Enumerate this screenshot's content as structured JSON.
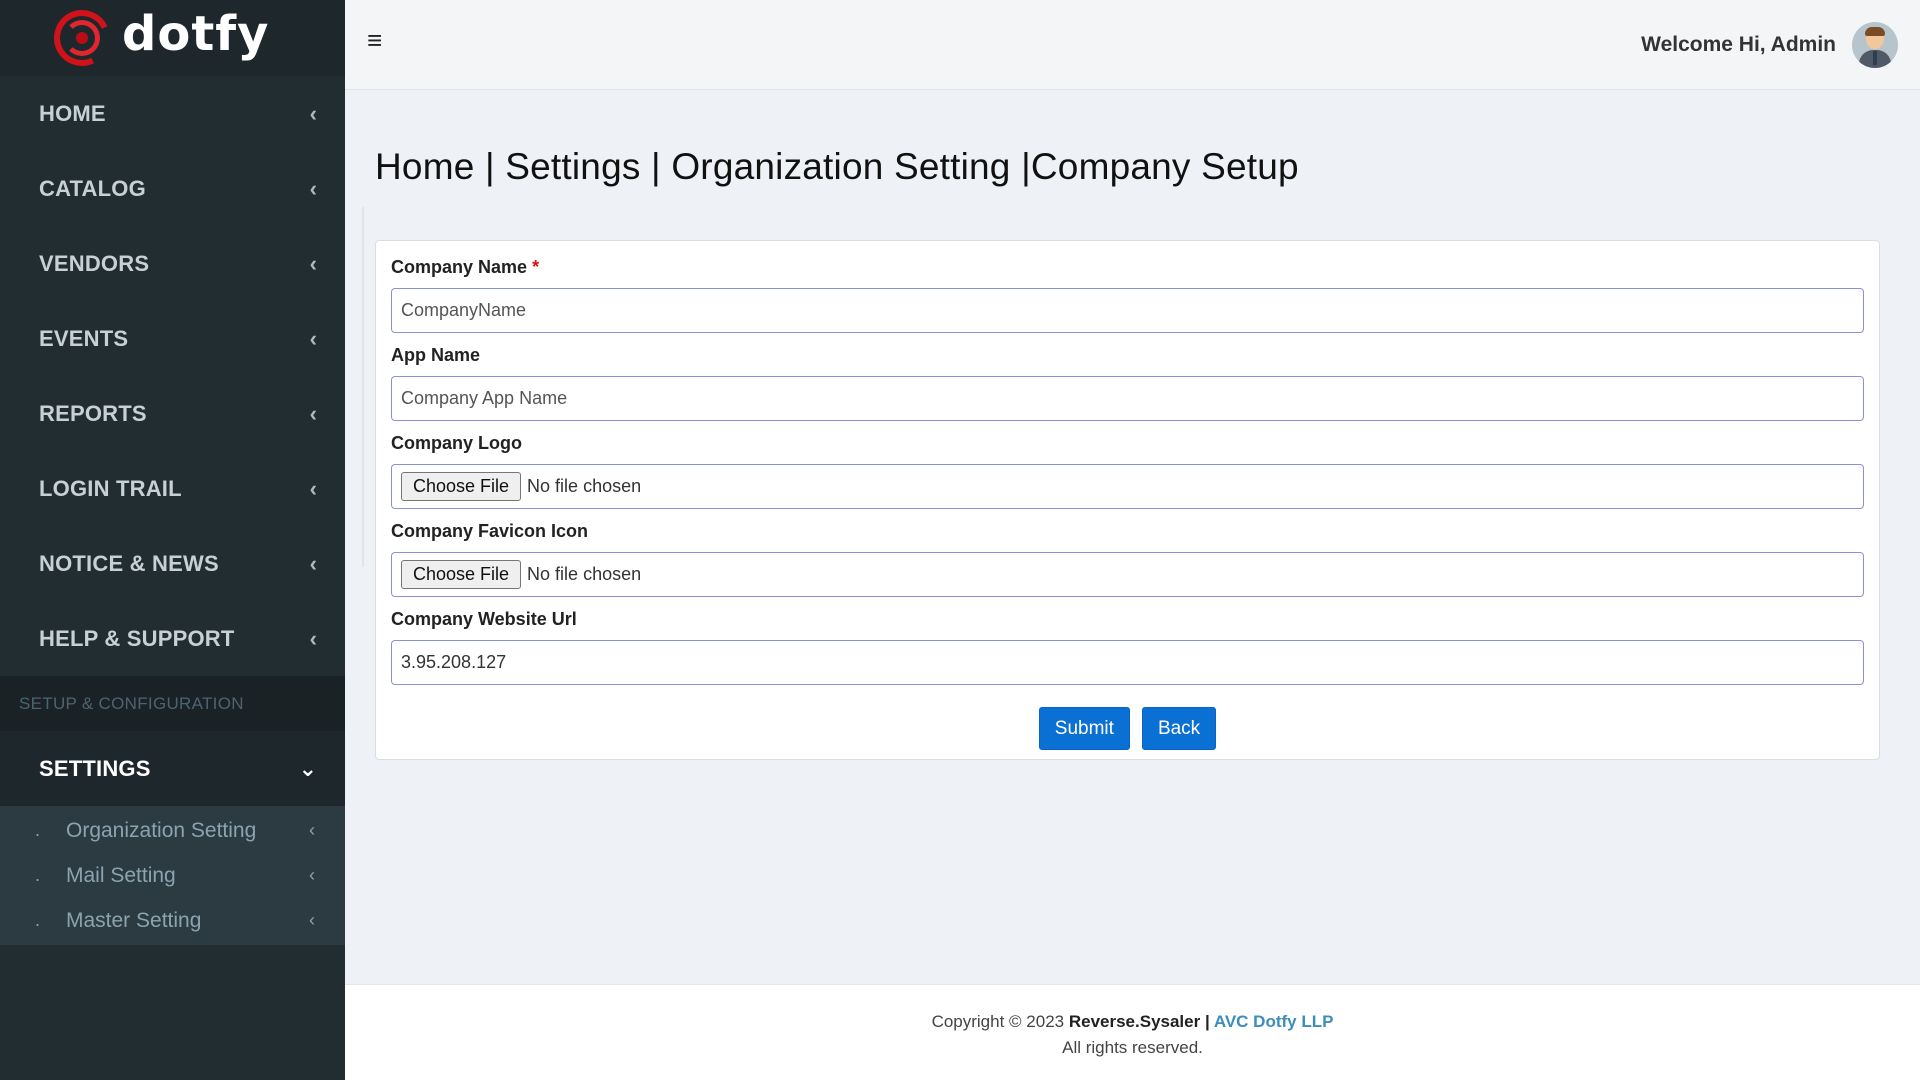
{
  "brand": {
    "name": "dotfy",
    "logo_icon": "dotfy-logo-icon"
  },
  "sidebar": {
    "items": [
      {
        "label": "HOME"
      },
      {
        "label": "CATALOG"
      },
      {
        "label": "VENDORS"
      },
      {
        "label": "EVENTS"
      },
      {
        "label": "REPORTS"
      },
      {
        "label": "LOGIN TRAIL"
      },
      {
        "label": "NOTICE & NEWS"
      },
      {
        "label": "HELP & SUPPORT"
      }
    ],
    "section_header": "SETUP & CONFIGURATION",
    "active_item": {
      "label": "SETTINGS"
    },
    "subitems": [
      {
        "bullet": ".",
        "label": "Organization Setting"
      },
      {
        "bullet": ".",
        "label": "Mail Setting"
      },
      {
        "bullet": ".",
        "label": "Master Setting"
      }
    ],
    "chevron_left": "‹",
    "chevron_down": "⌄"
  },
  "topbar": {
    "menu_glyph": "≡",
    "welcome": "Welcome Hi, Admin"
  },
  "page": {
    "title": "Home | Settings | Organization Setting |Company Setup"
  },
  "form": {
    "company_name": {
      "label": "Company Name",
      "required_mark": "*",
      "placeholder": "CompanyName",
      "value": ""
    },
    "app_name": {
      "label": "App Name",
      "placeholder": "Company App Name",
      "value": ""
    },
    "company_logo": {
      "label": "Company Logo",
      "button": "Choose File",
      "status": "No file chosen"
    },
    "favicon": {
      "label": "Company Favicon Icon",
      "button": "Choose File",
      "status": "No file chosen"
    },
    "website": {
      "label": "Company Website Url",
      "value": "3.95.208.127"
    },
    "submit_label": "Submit",
    "back_label": "Back"
  },
  "footer": {
    "prefix": "Copyright © 2023 ",
    "owner": "Reverse.Sysaler",
    "separator": " | ",
    "link": "AVC Dotfy LLP",
    "rights": "All rights reserved."
  },
  "colors": {
    "sidebar_bg": "#222d32",
    "primary_button": "#0b70d4",
    "required": "#e30d0d",
    "footer_link": "#3c8dbc"
  }
}
